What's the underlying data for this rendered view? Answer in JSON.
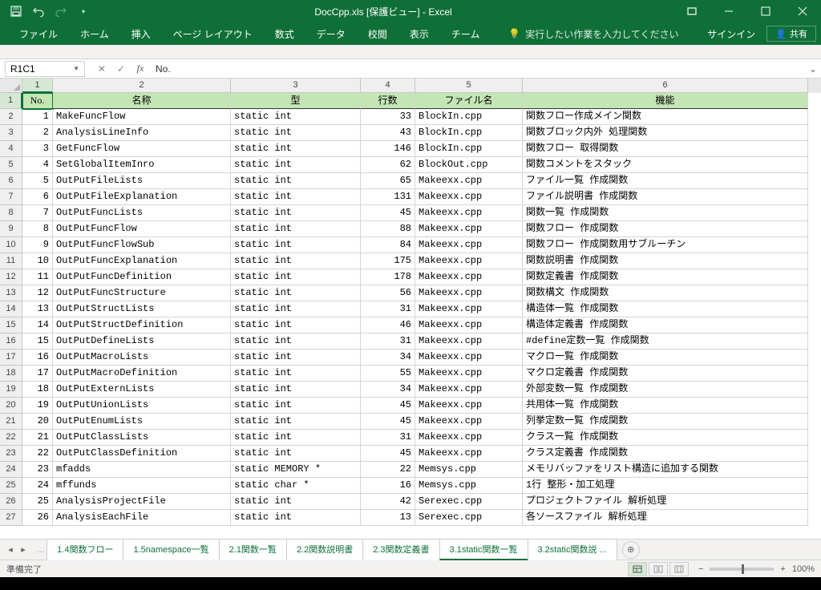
{
  "title": "DocCpp.xls [保護ビュー] - Excel",
  "qat": {
    "save": "save-icon",
    "undo": "undo-icon",
    "redo": "redo-icon"
  },
  "ribbon": {
    "tabs": [
      "ファイル",
      "ホーム",
      "挿入",
      "ページ レイアウト",
      "数式",
      "データ",
      "校閲",
      "表示",
      "チーム"
    ],
    "tellme": "実行したい作業を入力してください",
    "signin": "サインイン",
    "share": "共有"
  },
  "formula_bar": {
    "name_box": "R1C1",
    "formula": "No."
  },
  "col_headers": [
    "1",
    "2",
    "3",
    "4",
    "5",
    "6"
  ],
  "headers": {
    "no": "No.",
    "name": "名称",
    "type": "型",
    "lines": "行数",
    "file": "ファイル名",
    "func": "機能"
  },
  "rows": [
    {
      "no": 1,
      "name": "MakeFuncFlow",
      "type": "static int",
      "lines": 33,
      "file": "BlockIn.cpp",
      "func": "関数フロー作成メイン関数"
    },
    {
      "no": 2,
      "name": "AnalysisLineInfo",
      "type": "static int",
      "lines": 43,
      "file": "BlockIn.cpp",
      "func": "関数ブロック内外 処理関数"
    },
    {
      "no": 3,
      "name": "GetFuncFlow",
      "type": "static int",
      "lines": 146,
      "file": "BlockIn.cpp",
      "func": "関数フロー 取得関数"
    },
    {
      "no": 4,
      "name": "SetGlobalItemInro",
      "type": "static int",
      "lines": 62,
      "file": "BlockOut.cpp",
      "func": "関数コメントをスタック"
    },
    {
      "no": 5,
      "name": "OutPutFileLists",
      "type": "static int",
      "lines": 65,
      "file": "Makeexx.cpp",
      "func": "ファイル一覧 作成関数"
    },
    {
      "no": 6,
      "name": "OutPutFileExplanation",
      "type": "static int",
      "lines": 131,
      "file": "Makeexx.cpp",
      "func": "ファイル説明書 作成関数"
    },
    {
      "no": 7,
      "name": "OutPutFuncLists",
      "type": "static int",
      "lines": 45,
      "file": "Makeexx.cpp",
      "func": "関数一覧 作成関数"
    },
    {
      "no": 8,
      "name": "OutPutFuncFlow",
      "type": "static int",
      "lines": 88,
      "file": "Makeexx.cpp",
      "func": "関数フロー 作成関数"
    },
    {
      "no": 9,
      "name": "OutPutFuncFlowSub",
      "type": "static int",
      "lines": 84,
      "file": "Makeexx.cpp",
      "func": "関数フロー 作成関数用サブルーチン"
    },
    {
      "no": 10,
      "name": "OutPutFuncExplanation",
      "type": "static int",
      "lines": 175,
      "file": "Makeexx.cpp",
      "func": "関数説明書 作成関数"
    },
    {
      "no": 11,
      "name": "OutPutFuncDefinition",
      "type": "static int",
      "lines": 178,
      "file": "Makeexx.cpp",
      "func": "関数定義書 作成関数"
    },
    {
      "no": 12,
      "name": "OutPutFuncStructure",
      "type": "static int",
      "lines": 56,
      "file": "Makeexx.cpp",
      "func": "関数構文 作成関数"
    },
    {
      "no": 13,
      "name": "OutPutStructLists",
      "type": "static int",
      "lines": 31,
      "file": "Makeexx.cpp",
      "func": "構造体一覧 作成関数"
    },
    {
      "no": 14,
      "name": "OutPutStructDefinition",
      "type": "static int",
      "lines": 46,
      "file": "Makeexx.cpp",
      "func": "構造体定義書 作成関数"
    },
    {
      "no": 15,
      "name": "OutPutDefineLists",
      "type": "static int",
      "lines": 31,
      "file": "Makeexx.cpp",
      "func": "#define定数一覧 作成関数"
    },
    {
      "no": 16,
      "name": "OutPutMacroLists",
      "type": "static int",
      "lines": 34,
      "file": "Makeexx.cpp",
      "func": "マクロ一覧 作成関数"
    },
    {
      "no": 17,
      "name": "OutPutMacroDefinition",
      "type": "static int",
      "lines": 55,
      "file": "Makeexx.cpp",
      "func": "マクロ定義書 作成関数"
    },
    {
      "no": 18,
      "name": "OutPutExternLists",
      "type": "static int",
      "lines": 34,
      "file": "Makeexx.cpp",
      "func": "外部変数一覧 作成関数"
    },
    {
      "no": 19,
      "name": "OutPutUnionLists",
      "type": "static int",
      "lines": 45,
      "file": "Makeexx.cpp",
      "func": "共用体一覧 作成関数"
    },
    {
      "no": 20,
      "name": "OutPutEnumLists",
      "type": "static int",
      "lines": 45,
      "file": "Makeexx.cpp",
      "func": "列挙定数一覧 作成関数"
    },
    {
      "no": 21,
      "name": "OutPutClassLists",
      "type": "static int",
      "lines": 31,
      "file": "Makeexx.cpp",
      "func": "クラス一覧 作成関数"
    },
    {
      "no": 22,
      "name": "OutPutClassDefinition",
      "type": "static int",
      "lines": 45,
      "file": "Makeexx.cpp",
      "func": "クラス定義書 作成関数"
    },
    {
      "no": 23,
      "name": "mfadds",
      "type": "static MEMORY *",
      "lines": 22,
      "file": "Memsys.cpp",
      "func": "メモリバッファをリスト構造に追加する関数"
    },
    {
      "no": 24,
      "name": "mffunds",
      "type": "static char *",
      "lines": 16,
      "file": "Memsys.cpp",
      "func": "1行 整形・加工処理"
    },
    {
      "no": 25,
      "name": "AnalysisProjectFile",
      "type": "static int",
      "lines": 42,
      "file": "Serexec.cpp",
      "func": "プロジェクトファイル 解析処理"
    },
    {
      "no": 26,
      "name": "AnalysisEachFile",
      "type": "static int",
      "lines": 13,
      "file": "Serexec.cpp",
      "func": "各ソースファイル 解析処理"
    }
  ],
  "sheet_tabs": {
    "visible": [
      "1.4関数フロー",
      "1.5namespace一覧",
      "2.1関数一覧",
      "2.2関数説明書",
      "2.3関数定義書",
      "3.1static関数一覧",
      "3.2static関数説 ..."
    ],
    "active_index": 5
  },
  "statusbar": {
    "ready": "準備完了",
    "zoom": "100%"
  }
}
